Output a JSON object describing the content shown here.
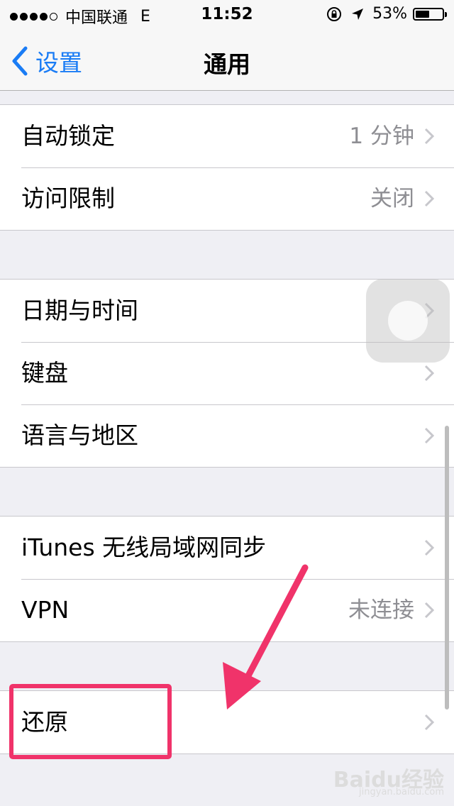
{
  "status_bar": {
    "signal_bars": 4,
    "signal_total": 5,
    "carrier": "中国联通",
    "network": "E",
    "time": "11:52",
    "battery_percent": "53%",
    "battery_level": 0.53
  },
  "nav": {
    "back_label": "设置",
    "title": "通用"
  },
  "groups": [
    [
      {
        "label": "自动锁定",
        "value": "1 分钟"
      },
      {
        "label": "访问限制",
        "value": "关闭"
      }
    ],
    [
      {
        "label": "日期与时间",
        "value": ""
      },
      {
        "label": "键盘",
        "value": ""
      },
      {
        "label": "语言与地区",
        "value": ""
      }
    ],
    [
      {
        "label": "iTunes 无线局域网同步",
        "value": ""
      },
      {
        "label": "VPN",
        "value": "未连接"
      }
    ],
    [
      {
        "label": "还原",
        "value": ""
      }
    ]
  ],
  "annotation": {
    "highlight_color": "#f0336a"
  },
  "watermark": {
    "logo": "Baidu经验",
    "url": "jingyan.baidu.com"
  },
  "colors": {
    "accent": "#1a7cf5",
    "background": "#efeff4",
    "secondary_text": "#8e8e93"
  },
  "icons": [
    "back-chevron-icon",
    "disclosure-chevron-icon",
    "rotation-lock-icon",
    "location-arrow-icon",
    "battery-icon"
  ]
}
